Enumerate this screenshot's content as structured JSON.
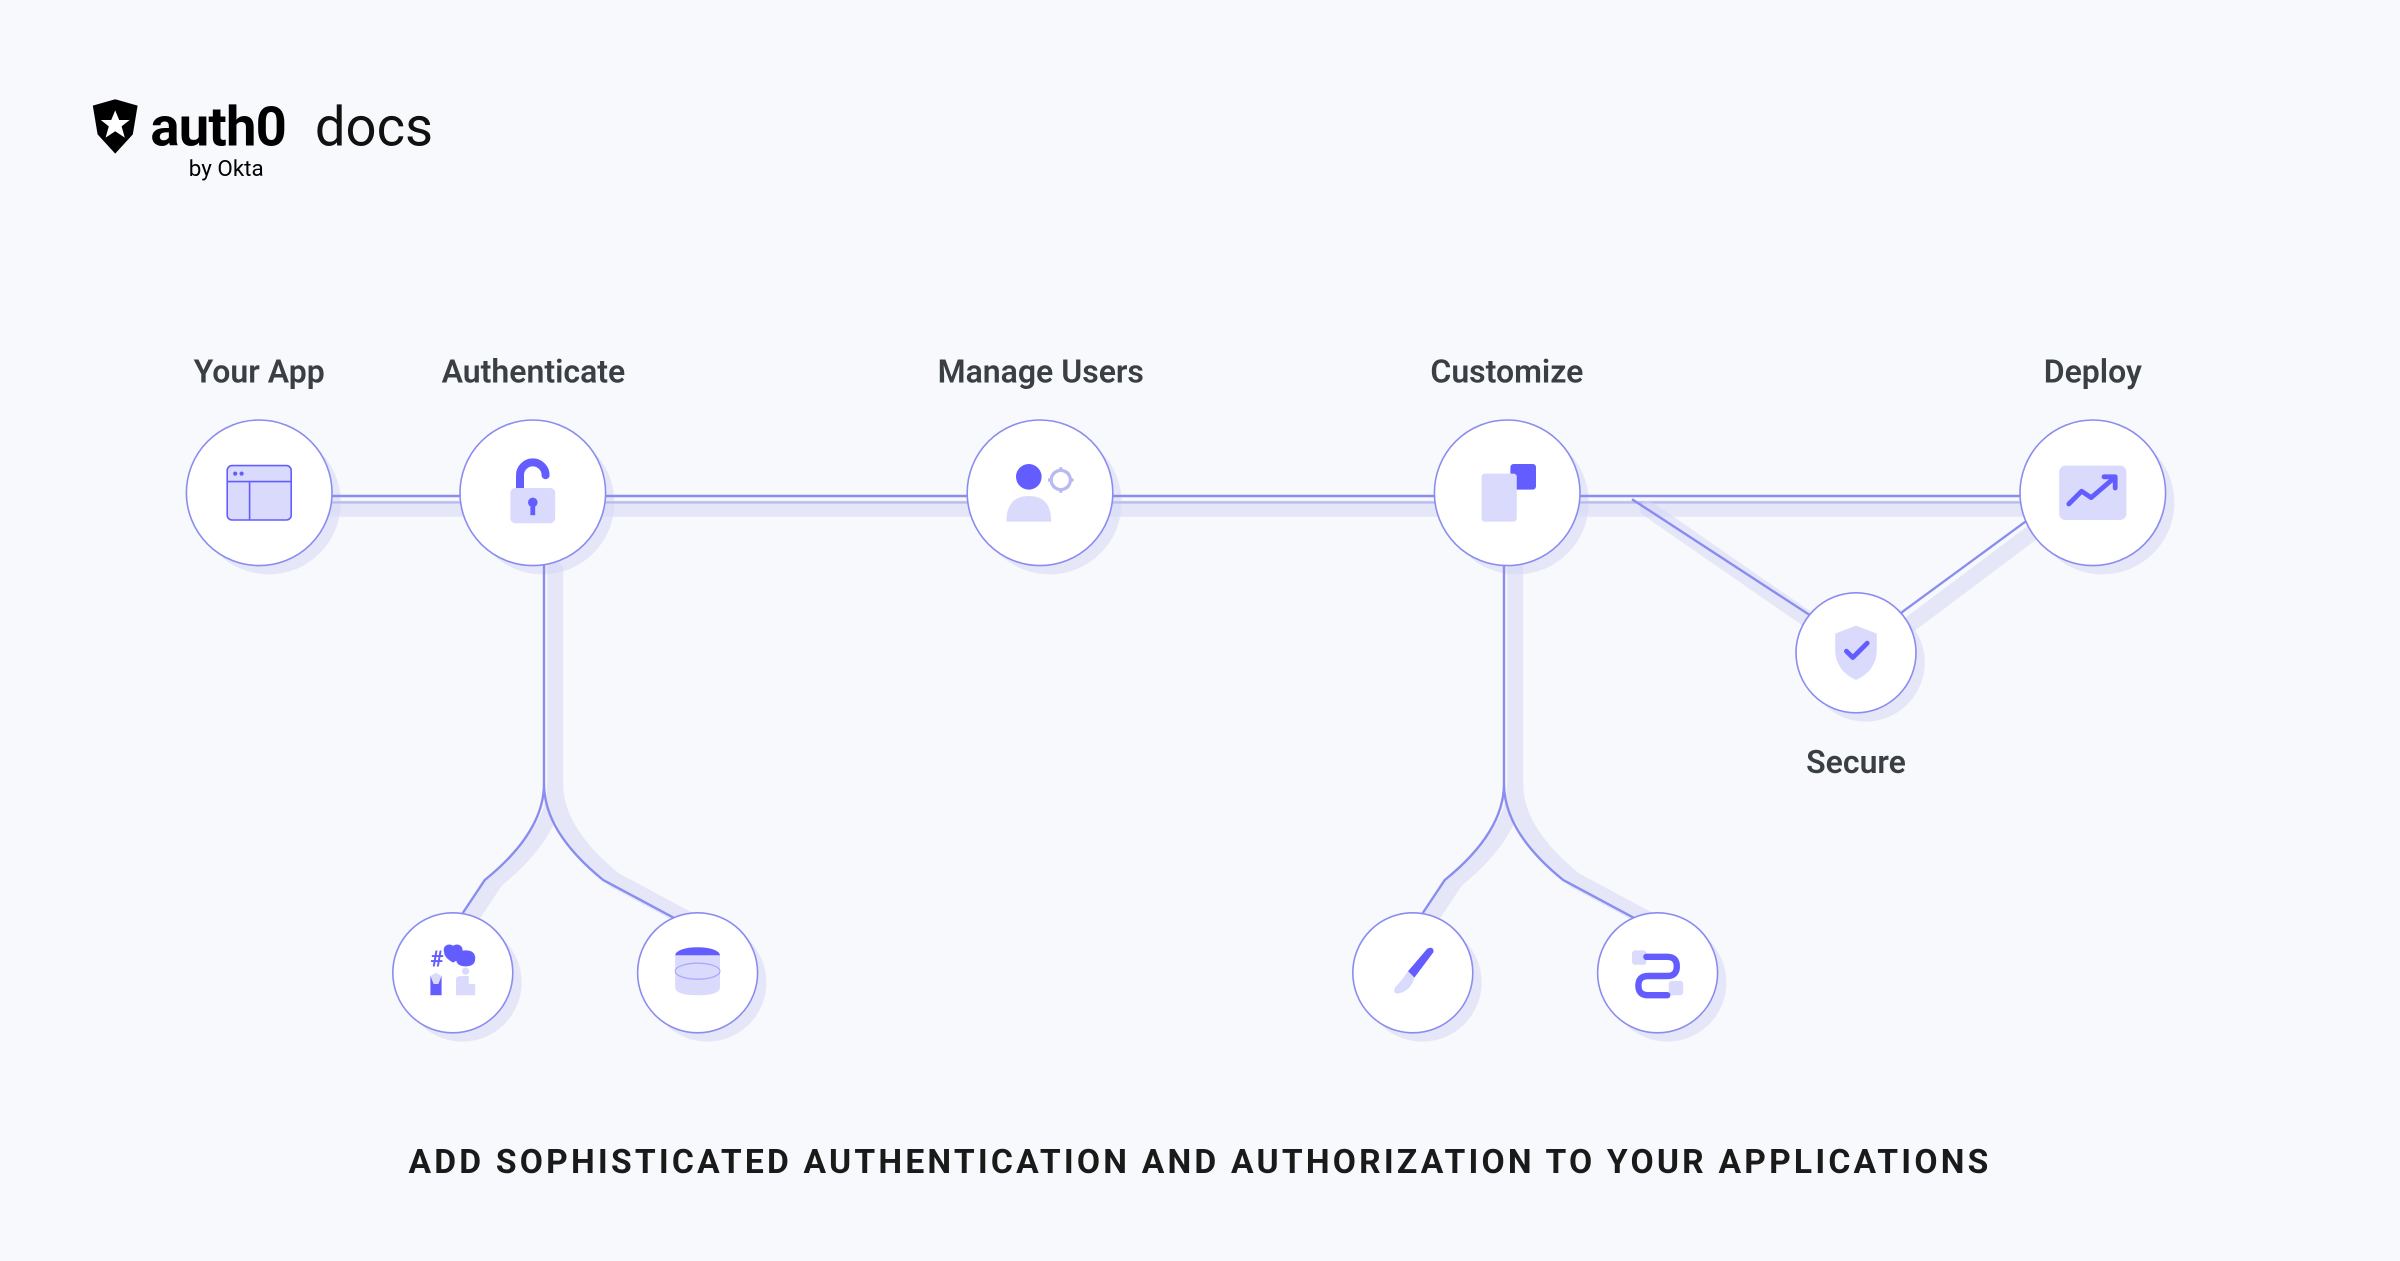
{
  "logo": {
    "wordmark": "auth0",
    "byline": "by Okta",
    "docs": "docs"
  },
  "nodes": {
    "your_app": "Your App",
    "authenticate": "Authenticate",
    "manage_users": "Manage Users",
    "customize": "Customize",
    "deploy": "Deploy",
    "secure": "Secure"
  },
  "tagline": "ADD SOPHISTICATED AUTHENTICATION AND AUTHORIZATION TO YOUR APPLICATIONS",
  "colors": {
    "accent": "#635dff",
    "accent_light": "#c7c8f7",
    "border": "#8a8cf0"
  }
}
